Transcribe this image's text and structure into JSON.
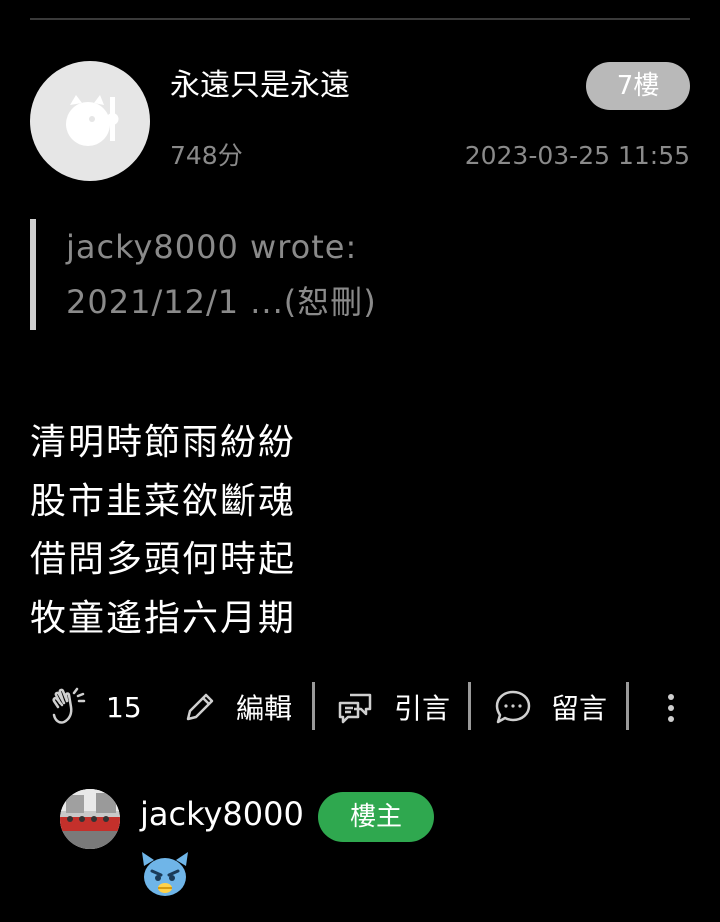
{
  "post": {
    "username": "永遠只是永遠",
    "points": "748分",
    "floor": "7樓",
    "timestamp": "2023-03-25 11:55",
    "quote": {
      "line1": "jacky8000 wrote:",
      "line2": "2021/12/1 ...(恕刪)"
    },
    "body_lines": [
      "清明時節雨紛紛",
      "股市韭菜欲斷魂",
      "借問多頭何時起",
      "牧童遙指六月期"
    ]
  },
  "actions": {
    "like_count": "15",
    "edit_label": "編輯",
    "quote_label": "引言",
    "comment_label": "留言"
  },
  "reply": {
    "author": "jacky8000",
    "badge": "樓主"
  },
  "colors": {
    "background": "#000000",
    "muted_text": "#8a8a8a",
    "floor_badge": "#b9b9b9",
    "owner_badge": "#2fa84f"
  },
  "icons": {
    "like": "clap-icon",
    "edit": "pencil-icon",
    "quote": "speech-bubbles-icon",
    "comment": "chat-bubble-icon",
    "more": "more-vertical-icon"
  }
}
